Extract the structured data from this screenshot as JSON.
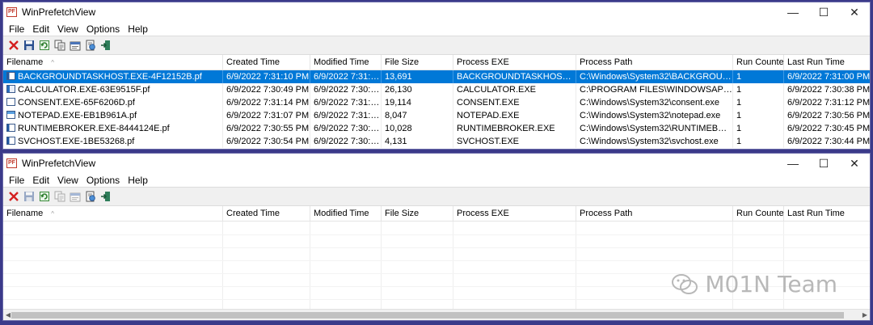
{
  "window_top": {
    "title": "WinPrefetchView",
    "app_icon_text": "PF",
    "controls": {
      "minimize": "—",
      "maximize": "☐",
      "close": "✕"
    },
    "menu": [
      "File",
      "Edit",
      "View",
      "Options",
      "Help"
    ],
    "columns": [
      "Filename",
      "Created Time",
      "Modified Time",
      "File Size",
      "Process EXE",
      "Process Path",
      "Run Counter",
      "Last Run Time"
    ],
    "sort_indicator": "^",
    "rows": [
      {
        "filename": "BACKGROUNDTASKHOST.EXE-4F12152B.pf",
        "created": "6/9/2022 7:31:10 PM",
        "modified": "6/9/2022 7:31:10 ...",
        "size": "13,691",
        "exe": "BACKGROUNDTASKHOST.EXE",
        "path": "C:\\Windows\\System32\\BACKGROUNDTA...",
        "count": "1",
        "last": "6/9/2022 7:31:00 PM",
        "selected": true
      },
      {
        "filename": "CALCULATOR.EXE-63E9515F.pf",
        "created": "6/9/2022 7:30:49 PM",
        "modified": "6/9/2022 7:30:49 ...",
        "size": "26,130",
        "exe": "CALCULATOR.EXE",
        "path": "C:\\PROGRAM FILES\\WINDOWSAPPS\\MIC...",
        "count": "1",
        "last": "6/9/2022 7:30:38 PM"
      },
      {
        "filename": "CONSENT.EXE-65F6206D.pf",
        "created": "6/9/2022 7:31:14 PM",
        "modified": "6/9/2022 7:31:14 ...",
        "size": "19,114",
        "exe": "CONSENT.EXE",
        "path": "C:\\Windows\\System32\\consent.exe",
        "count": "1",
        "last": "6/9/2022 7:31:12 PM"
      },
      {
        "filename": "NOTEPAD.EXE-EB1B961A.pf",
        "created": "6/9/2022 7:31:07 PM",
        "modified": "6/9/2022 7:31:07 ...",
        "size": "8,047",
        "exe": "NOTEPAD.EXE",
        "path": "C:\\Windows\\System32\\notepad.exe",
        "count": "1",
        "last": "6/9/2022 7:30:56 PM"
      },
      {
        "filename": "RUNTIMEBROKER.EXE-8444124E.pf",
        "created": "6/9/2022 7:30:55 PM",
        "modified": "6/9/2022 7:30:55 ...",
        "size": "10,028",
        "exe": "RUNTIMEBROKER.EXE",
        "path": "C:\\Windows\\System32\\RUNTIMEBROKER...",
        "count": "1",
        "last": "6/9/2022 7:30:45 PM"
      },
      {
        "filename": "SVCHOST.EXE-1BE53268.pf",
        "created": "6/9/2022 7:30:54 PM",
        "modified": "6/9/2022 7:30:54 ...",
        "size": "4,131",
        "exe": "SVCHOST.EXE",
        "path": "C:\\Windows\\System32\\svchost.exe",
        "count": "1",
        "last": "6/9/2022 7:30:44 PM"
      }
    ]
  },
  "window_bottom": {
    "title": "WinPrefetchView",
    "app_icon_text": "PF",
    "controls": {
      "minimize": "—",
      "maximize": "☐",
      "close": "✕"
    },
    "menu": [
      "File",
      "Edit",
      "View",
      "Options",
      "Help"
    ],
    "columns": [
      "Filename",
      "Created Time",
      "Modified Time",
      "File Size",
      "Process EXE",
      "Process Path",
      "Run Counter",
      "Last Run Time"
    ],
    "sort_indicator": "^",
    "rows": []
  },
  "toolbar_icons": [
    "delete-icon",
    "save-icon",
    "refresh-icon",
    "copy-icon",
    "properties-icon",
    "html-report-icon",
    "exit-icon"
  ],
  "colors": {
    "background": "#3b3a8a",
    "selection": "#0078d7"
  },
  "watermark": "M01N Team"
}
